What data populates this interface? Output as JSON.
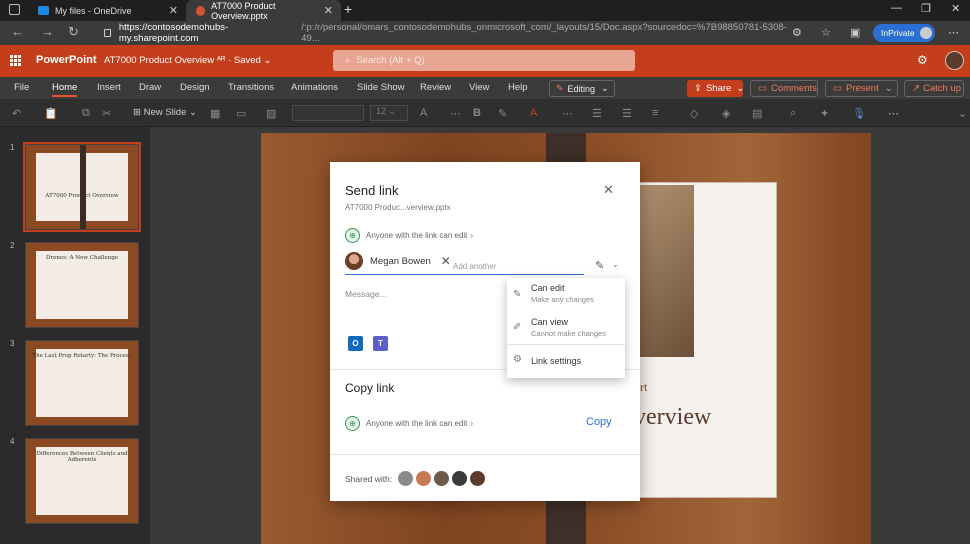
{
  "browser": {
    "tabs": [
      {
        "label": "My files - OneDrive"
      },
      {
        "label": "AT7000 Product Overview.pptx"
      }
    ],
    "url_host": "https://contosodemohubs-my.sharepoint.com",
    "url_path": "/:p:/r/personal/omars_contosodemohubs_onmicrosoft_com/_layouts/15/Doc.aspx?sourcedoc=%7B98850781-5308-49...",
    "inprivate_label": "InPrivate"
  },
  "ppt": {
    "app_name": "PowerPoint",
    "doc_title": "AT7000 Product Overview",
    "saved_status": "Saved",
    "search_placeholder": "Search (Alt + Q)",
    "tabs": [
      "File",
      "Home",
      "Insert",
      "Draw",
      "Design",
      "Transitions",
      "Animations",
      "Slide Show",
      "Review",
      "View",
      "Help"
    ],
    "editing_label": "Editing",
    "share_label": "Share",
    "comments_label": "Comments",
    "present_label": "Present",
    "catchup_label": "Catch up",
    "new_slide_label": "New Slide",
    "font_size": "12"
  },
  "slides": [
    {
      "num": "1",
      "title": "AT7000 Product Overview"
    },
    {
      "num": "2",
      "title": "Drones: A New Challenge"
    },
    {
      "num": "3",
      "title": "The Last Prop Rotarty: The Process"
    },
    {
      "num": "4",
      "title": "Differences Between Clients and Adherents"
    }
  ],
  "slide_main": {
    "text1": "ort",
    "text2": "verview"
  },
  "dialog": {
    "title": "Send link",
    "filename": "AT7000 Produc...verview.pptx",
    "permission": "Anyone with the link can edit",
    "chip_name": "Megan Bowen",
    "add_another": "Add another",
    "message_placeholder": "Message...",
    "copy_title": "Copy link",
    "copy_permission": "Anyone with the link can edit",
    "copy_button": "Copy",
    "shared_with": "Shared with:"
  },
  "menu": {
    "can_edit": "Can edit",
    "can_edit_desc": "Make any changes",
    "can_view": "Can view",
    "can_view_desc": "Cannot make changes",
    "link_settings": "Link settings"
  },
  "colors": {
    "brand": "#c43e1c",
    "accent_blue": "#2b6fd4",
    "globe_green": "#2e9a4a"
  }
}
